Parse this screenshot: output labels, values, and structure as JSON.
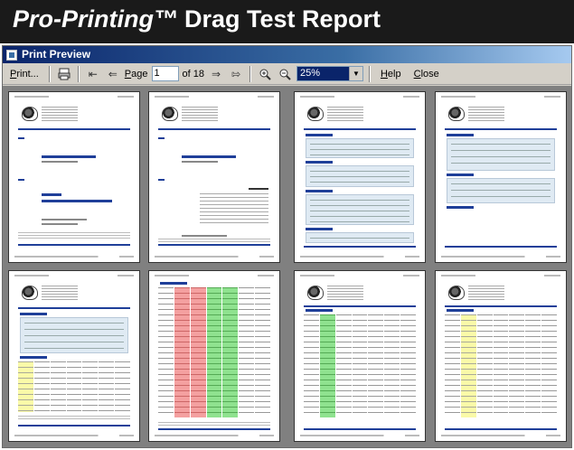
{
  "banner": {
    "brand": "Pro-Printing™",
    "rest": "Drag Test Report"
  },
  "window": {
    "title": "Print Preview"
  },
  "toolbar": {
    "print_label": "Print...",
    "page_label": "Page",
    "page_value": "1",
    "page_of": "of 18",
    "zoom_value": "25%",
    "help_label": "Help",
    "close_label": "Close",
    "icons": [
      "printer-setup-icon",
      "first-page-icon",
      "prev-page-icon",
      "next-page-icon",
      "last-page-icon",
      "zoom-in-icon",
      "zoom-out-icon",
      "dropdown-arrow-icon"
    ]
  },
  "preview": {
    "visible_pages": 8,
    "colors": {
      "accent_blue": "#1f3f99",
      "red_cells": "#f4a0a0",
      "green_cells": "#8fe28f",
      "yellow_cells": "#fafaa8",
      "light_blue_boxes": "#dfeaf3"
    }
  }
}
